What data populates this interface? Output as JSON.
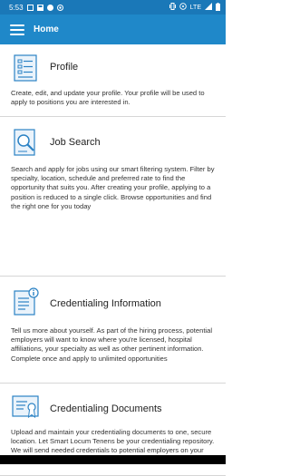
{
  "status_bar": {
    "time": "5:53",
    "network": "LTE"
  },
  "app_bar": {
    "title": "Home"
  },
  "cards": [
    {
      "title": "Profile",
      "icon": "profile-form-icon",
      "description": "Create, edit, and update your profile. Your profile will be used to apply to positions you are interested in."
    },
    {
      "title": "Job Search",
      "icon": "job-search-icon",
      "description": "Search and apply for jobs using our smart filtering system. Filter by specialty, location, schedule and preferred rate to find the opportunity that suits you. After creating your profile, applying to a position is reduced to a single click. Browse opportunities and find the right one for you today"
    },
    {
      "title": "Credentialing Information",
      "icon": "credentialing-info-icon",
      "description": "Tell us more about yourself. As part of the hiring process, potential employers will want to know where you're licensed, hospital affiliations, your specialty as well as other pertinent information. Complete once and apply to unlimited opportunities"
    },
    {
      "title": "Credentialing Documents",
      "icon": "credentialing-documents-icon",
      "description": "Upload and maintain your credentialing documents to one, secure location. Let Smart Locum Tenens be your credentialing repository. We will send needed credentials to potential employers on your behalf."
    }
  ],
  "colors": {
    "status_bar": "#1a78b8",
    "app_bar": "#1f88c9",
    "icon_blue": "#2b82c4"
  }
}
